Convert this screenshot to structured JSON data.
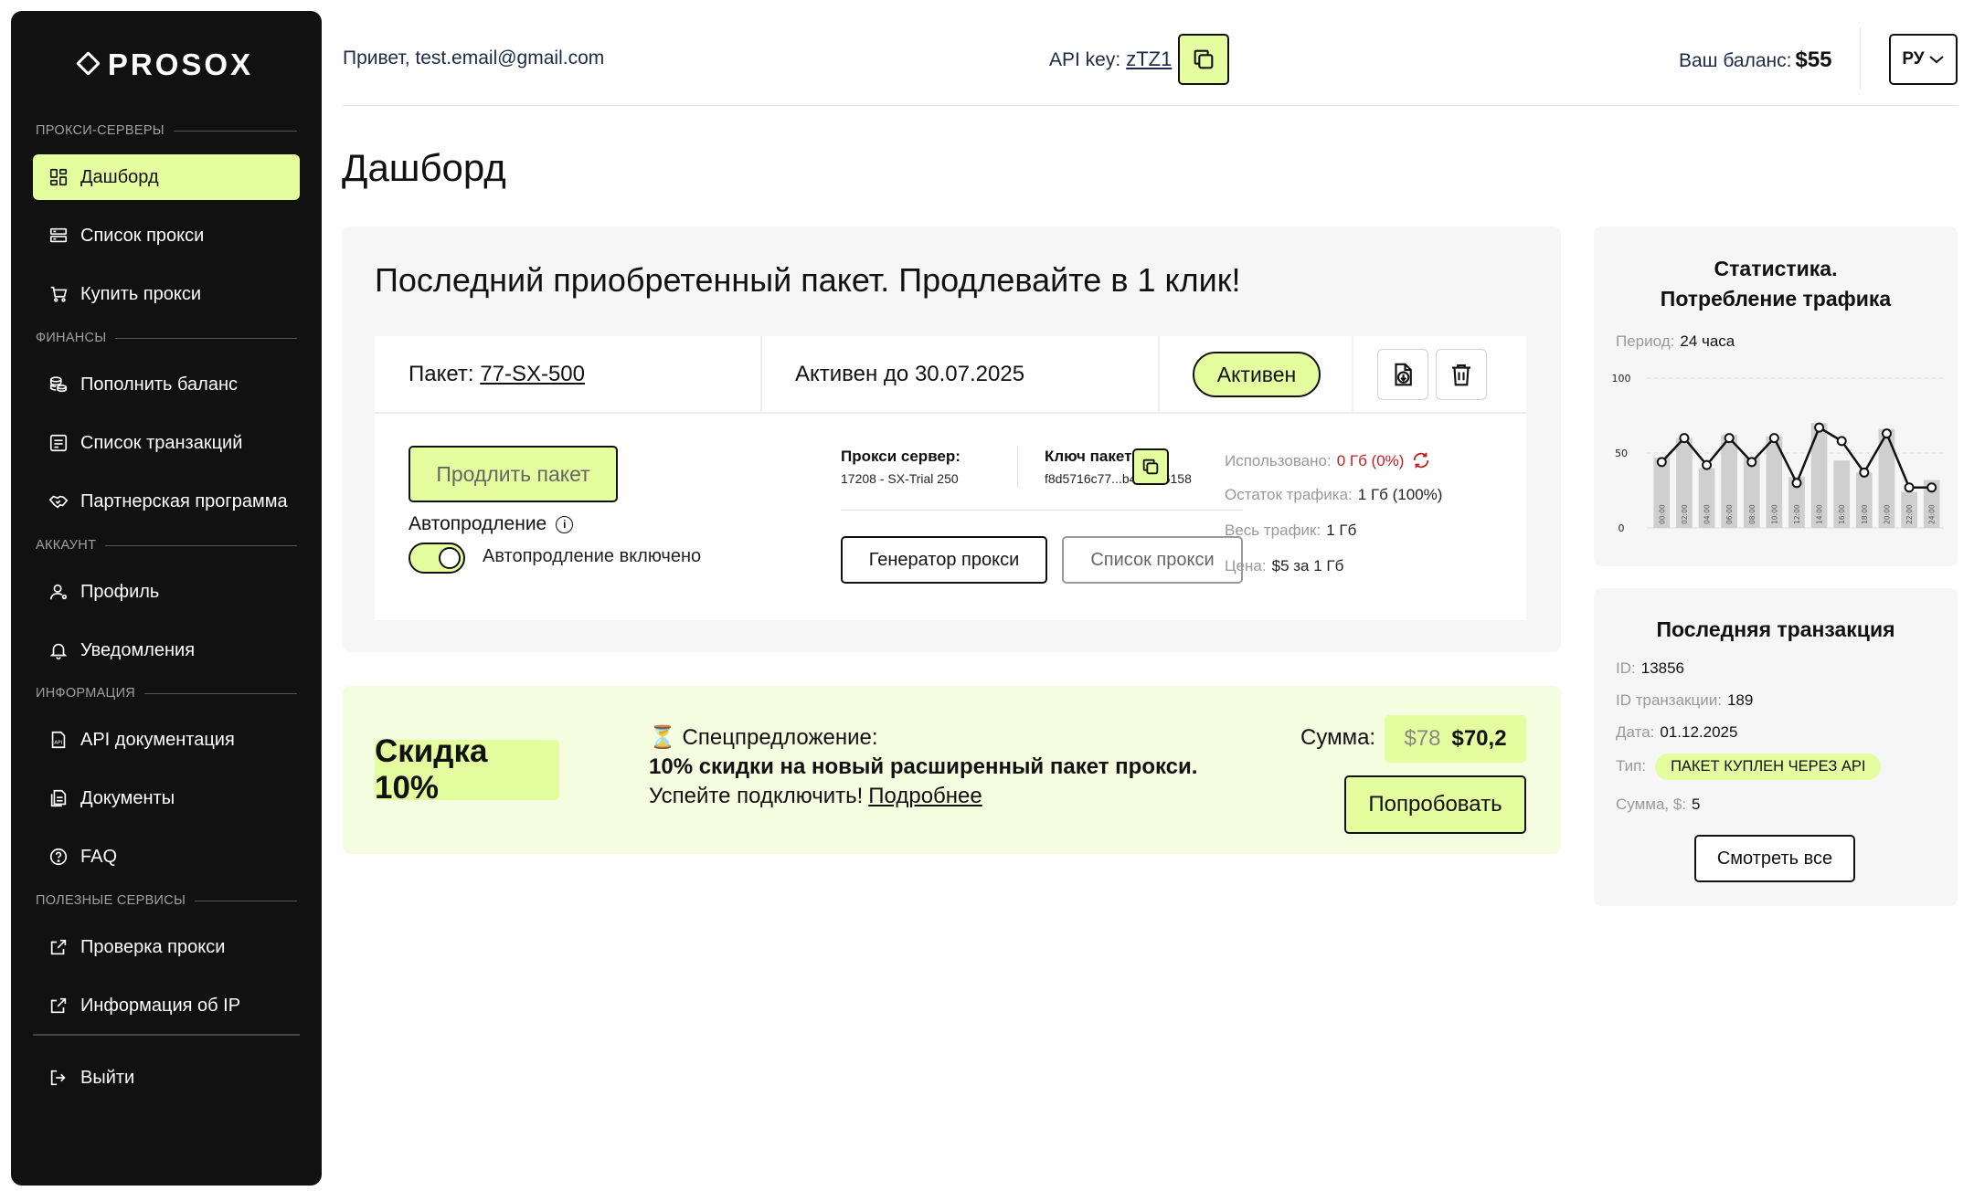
{
  "brand": {
    "name": "PROSOX"
  },
  "sidebar": {
    "sections": {
      "proxy": "ПРОКСИ-СЕРВЕРЫ",
      "finance": "ФИНАНСЫ",
      "account": "АККАУНТ",
      "info": "ИНФОРМАЦИЯ",
      "services": "ПОЛЕЗНЫЕ СЕРВИСЫ"
    },
    "items": {
      "dashboard": "Дашборд",
      "proxy_list": "Список прокси",
      "buy_proxy": "Купить прокси",
      "top_up": "Пополнить баланс",
      "transactions": "Список транзакций",
      "partner": "Партнерская программа",
      "profile": "Профиль",
      "notifications": "Уведомления",
      "api_docs": "API документация",
      "documents": "Документы",
      "faq": "FAQ",
      "check_proxy": "Проверка прокси",
      "ip_info": "Информация об IP",
      "logout": "Выйти"
    }
  },
  "header": {
    "greeting": "Привет,",
    "email": "test.email@gmail.com",
    "api_label": "API key:",
    "api_key": "zTZ1",
    "balance_label": "Ваш баланс:",
    "balance": "$55",
    "lang": "РУ"
  },
  "page": {
    "title": "Дашборд"
  },
  "package_card": {
    "title": "Последний приобретенный пакет.  Продлевайте в 1 клик!",
    "package_label": "Пакет:",
    "package_name": "77-SX-500",
    "active_until": "Активен до 30.07.2025",
    "status": "Активен",
    "extend_button": "Продлить пакет",
    "autorenew_label": "Автопродление",
    "autorenew_state": "Автопродление включено",
    "autorenew_on": true,
    "server_label": "Прокси сервер:",
    "server_value": "17208 - SX-Trial 250",
    "key_label": "Ключ пакета:",
    "key_value": "f8d5716c77...b4c5116158",
    "generator_button": "Генератор прокси",
    "list_button": "Список прокси",
    "used_label": "Использовано:",
    "used_value": "0 Гб (0%)",
    "remaining_label": "Остаток трафика:",
    "remaining_value": "1 Гб (100%)",
    "total_label": "Весь трафик:",
    "total_value": "1 Гб",
    "price_label": "Цена:",
    "price_value": "$5 за 1 Гб"
  },
  "promo": {
    "discount": "Скидка 10%",
    "line1": "⏳ Спецпредложение:",
    "line2": "10% скидки на новый расширенный пакет прокси.",
    "line3": "Успейте подключить!",
    "link": "Подробнее",
    "sum_label": "Сумма:",
    "old_price": "$78",
    "new_price": "$70,2",
    "try_button": "Попробовать"
  },
  "stats": {
    "title_line1": "Статистика.",
    "title_line2": "Потребление трафика",
    "period_label": "Период:",
    "period_value": "24 часа"
  },
  "chart_data": {
    "type": "bar",
    "categories": [
      "00:00",
      "02:00",
      "04:00",
      "06:00",
      "08:00",
      "10:00",
      "12:00",
      "14:00",
      "16:00",
      "18:00",
      "20:00",
      "22:00",
      "24:00"
    ],
    "series": [
      {
        "type": "bar",
        "values": [
          47,
          60,
          40,
          62,
          47,
          61,
          34,
          70,
          45,
          37,
          66,
          24,
          32
        ]
      },
      {
        "type": "line",
        "values": [
          44,
          60,
          42,
          60,
          44,
          60,
          30,
          67,
          58,
          37,
          63,
          27,
          27
        ]
      }
    ],
    "ylim": [
      0,
      100
    ],
    "yticks": [
      0,
      50,
      100
    ],
    "grid": true,
    "colors": {
      "bar": "#cfcfcf",
      "line": "#111111"
    }
  },
  "last_transaction": {
    "title": "Последняя транзакция",
    "id_label": "ID:",
    "id_value": "13856",
    "tx_label": "ID транзакции:",
    "tx_value": "189",
    "date_label": "Дата:",
    "date_value": "01.12.2025",
    "type_label": "Тип:",
    "type_value": "ПАКЕТ КУПЛЕН ЧЕРЕЗ API",
    "sum_label": "Сумма, $:",
    "sum_value": "5",
    "view_all": "Смотреть все"
  },
  "colors": {
    "accent": "#e4fd9f",
    "sidebar": "#111111",
    "panel": "#f6f6f6",
    "promo_bg": "#f4fde0",
    "danger": "#c21e1e"
  }
}
